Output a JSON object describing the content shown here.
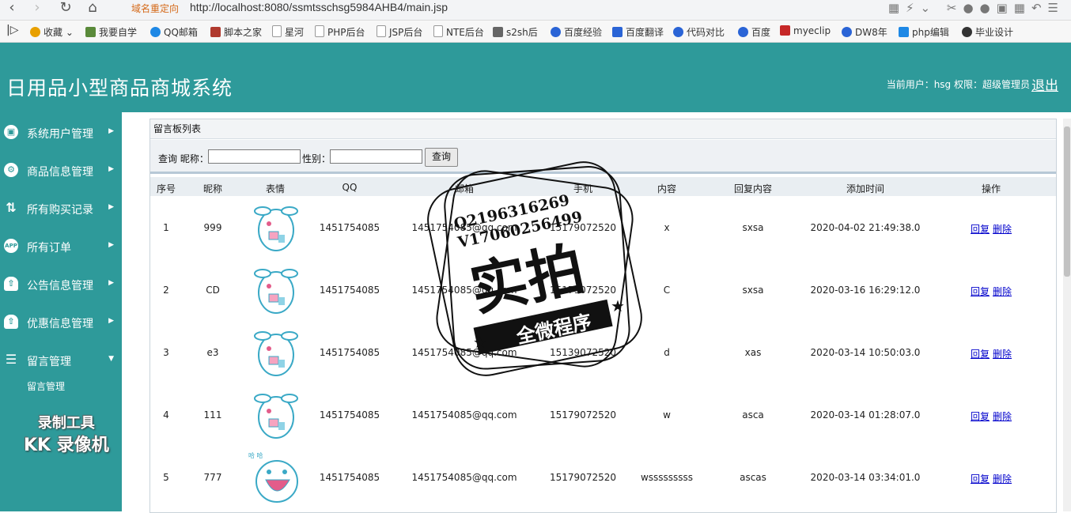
{
  "browser": {
    "url": "http://localhost:8080/ssmtsschsg5984AHB4/main.jsp",
    "redirect_badge": "域名重定向"
  },
  "bookmarks": [
    {
      "label": "收藏",
      "icon": "star-icon",
      "color": "#e8a000"
    },
    {
      "label": "我要自学",
      "icon": "bookmark-icon",
      "color": "#5a8a3a"
    },
    {
      "label": "QQ邮箱",
      "icon": "qq-icon",
      "color": "#1e88e5"
    },
    {
      "label": "脚本之家",
      "icon": "bookmark-icon",
      "color": "#b03a2e"
    },
    {
      "label": "星河",
      "icon": "page-icon",
      "color": "#cccccc"
    },
    {
      "label": "PHP后台",
      "icon": "page-icon",
      "color": "#cccccc"
    },
    {
      "label": "JSP后台",
      "icon": "page-icon",
      "color": "#cccccc"
    },
    {
      "label": "NTE后台",
      "icon": "page-icon",
      "color": "#cccccc"
    },
    {
      "label": "s2sh后",
      "icon": "bookmark-icon",
      "color": "#666666"
    },
    {
      "label": "百度经验",
      "icon": "paw-icon",
      "color": "#2a64d6"
    },
    {
      "label": "百度翻译",
      "icon": "translate-icon",
      "color": "#2a64d6"
    },
    {
      "label": "代码对比",
      "icon": "bookmark-icon",
      "color": "#2a64d6"
    },
    {
      "label": "百度",
      "icon": "paw-icon",
      "color": "#2a64d6"
    },
    {
      "label": "myeclip",
      "icon": "bookmark-icon",
      "color": "#c62828"
    },
    {
      "label": "DW8年",
      "icon": "paw-icon",
      "color": "#2a64d6"
    },
    {
      "label": "php编辑",
      "icon": "bookmark-icon",
      "color": "#1e88e5"
    },
    {
      "label": "毕业设计",
      "icon": "bookmark-icon",
      "color": "#333333"
    }
  ],
  "header": {
    "title": "日用品小型商品商城系统",
    "user_info": "当前用户：hsg 权限：超级管理员",
    "logout": "退出"
  },
  "sidebar": {
    "items": [
      {
        "label": "系统用户管理",
        "icon": "monitor-icon"
      },
      {
        "label": "商品信息管理",
        "icon": "users-gear-icon"
      },
      {
        "label": "所有购买记录",
        "icon": "exchange-icon"
      },
      {
        "label": "所有订单",
        "icon": "app-icon"
      },
      {
        "label": "公告信息管理",
        "icon": "cloud-icon"
      },
      {
        "label": "优惠信息管理",
        "icon": "cloud-icon"
      },
      {
        "label": "留言管理",
        "icon": "stack-icon"
      }
    ],
    "sub_item": "留言管理",
    "watermark_line1": "录制工具",
    "watermark_line2": "KK 录像机"
  },
  "panel": {
    "title": "留言板列表",
    "search_prefix": "查询 昵称：",
    "gender_label": "性别：",
    "search_button": "查询",
    "nickname_value": "",
    "gender_value": ""
  },
  "table": {
    "headers": [
      "序号",
      "昵称",
      "表情",
      "QQ",
      "邮箱",
      "手机",
      "内容",
      "回复内容",
      "添加时间",
      "操作"
    ],
    "rows": [
      {
        "no": "1",
        "nick": "999",
        "qq": "1451754085",
        "email": "1451754085@qq.com",
        "phone": "15179072520",
        "content": "x",
        "reply": "sxsa",
        "time": "2020-04-02 21:49:38.0",
        "face": "face-bunny-icon"
      },
      {
        "no": "2",
        "nick": "CD",
        "qq": "1451754085",
        "email": "1451754085@qq.com",
        "phone": "15179072520",
        "content": "C",
        "reply": "sxsa",
        "time": "2020-03-16 16:29:12.0",
        "face": "face-bunny-icon"
      },
      {
        "no": "3",
        "nick": "e3",
        "qq": "1451754085",
        "email": "1451754085@qq.com",
        "phone": "15139072520",
        "content": "d",
        "reply": "xas",
        "time": "2020-03-14 10:50:03.0",
        "face": "face-bunny-icon"
      },
      {
        "no": "4",
        "nick": "111",
        "qq": "1451754085",
        "email": "1451754085@qq.com",
        "phone": "15179072520",
        "content": "w",
        "reply": "asca",
        "time": "2020-03-14 01:28:07.0",
        "face": "face-bunny-icon"
      },
      {
        "no": "5",
        "nick": "777",
        "qq": "1451754085",
        "email": "1451754085@qq.com",
        "phone": "15179072520",
        "content": "wsssssssss",
        "reply": "ascas",
        "time": "2020-03-14 03:34:01.0",
        "face": "face-laugh-icon"
      }
    ],
    "op_reply": "回复",
    "op_delete": "删除"
  },
  "stamp": {
    "line1": "Q2196316269",
    "line2": "V17060256499",
    "main": "实拍",
    "banner": "全微程序"
  }
}
